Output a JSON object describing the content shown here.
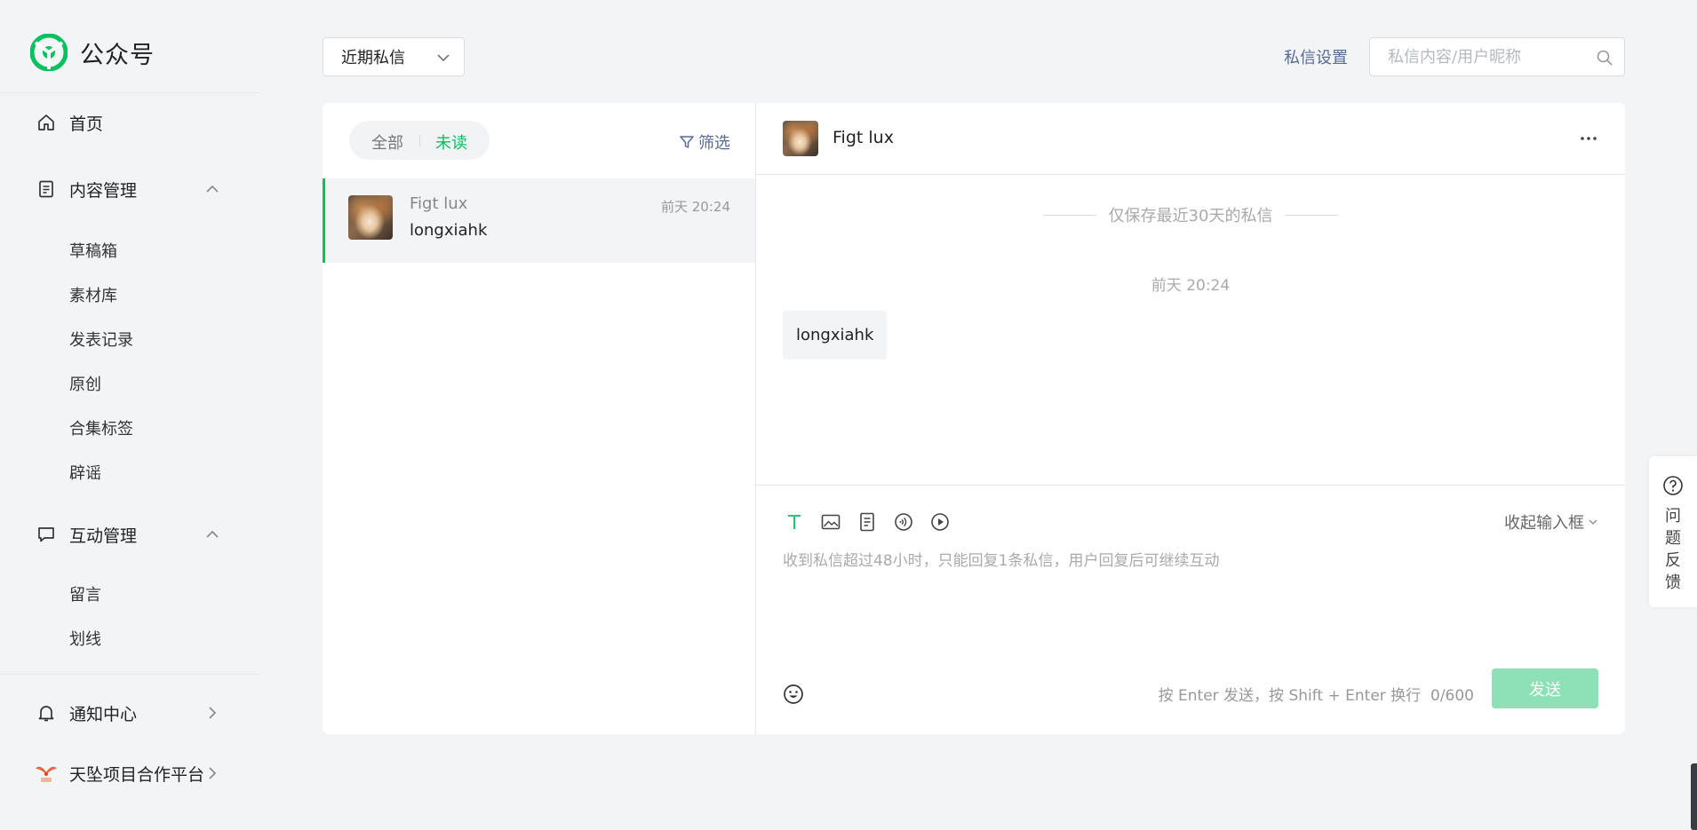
{
  "app": {
    "title": "公众号"
  },
  "sidebar": {
    "home": {
      "label": "首页",
      "icon": "home-icon"
    },
    "content": {
      "label": "内容管理",
      "icon": "document-icon",
      "expanded": true,
      "items": [
        {
          "label": "草稿箱"
        },
        {
          "label": "素材库"
        },
        {
          "label": "发表记录"
        },
        {
          "label": "原创"
        },
        {
          "label": "合集标签"
        },
        {
          "label": "辟谣"
        }
      ]
    },
    "interaction": {
      "label": "互动管理",
      "icon": "chat-bubble-icon",
      "expanded": true,
      "items": [
        {
          "label": "留言"
        },
        {
          "label": "划线"
        }
      ]
    },
    "notifications": {
      "label": "通知中心",
      "icon": "bell-icon"
    },
    "partner": {
      "label": "天坠项目合作平台",
      "icon": "tianzhui-logo-icon"
    }
  },
  "topbar": {
    "filter_select": {
      "selected": "近期私信"
    },
    "settings_link": "私信设置",
    "search": {
      "placeholder": "私信内容/用户昵称",
      "value": ""
    }
  },
  "conversation_list": {
    "tabs": [
      {
        "label": "全部",
        "active": false
      },
      {
        "label": "未读",
        "active": true
      }
    ],
    "filter_label": "筛选",
    "items": [
      {
        "name": "Figt lux",
        "preview": "longxiahk",
        "time": "前天 20:24",
        "selected": true
      }
    ]
  },
  "chat": {
    "user_name": "Figt lux",
    "notice": "仅保存最近30天的私信",
    "messages": [
      {
        "time": "前天 20:24",
        "text": "longxiahk",
        "direction": "incoming"
      }
    ],
    "composer": {
      "tools": [
        "text-icon",
        "image-icon",
        "article-icon",
        "audio-icon",
        "video-icon"
      ],
      "active_tool": "text-icon",
      "collapse_label": "收起输入框",
      "placeholder": "收到私信超过48小时，只能回复1条私信，用户回复后可继续互动",
      "hint": "按 Enter 发送，按 Shift + Enter 换行",
      "counter": "0/600",
      "send_label": "发送"
    }
  },
  "feedback": {
    "label": "问题反馈"
  },
  "colors": {
    "brand_green": "#07c160",
    "link_blue": "#576b95",
    "send_disabled": "#8ee0b6",
    "page_bg": "#f3f4f6"
  }
}
